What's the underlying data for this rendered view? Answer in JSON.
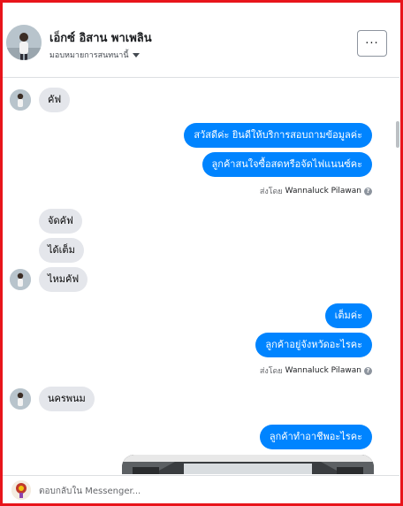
{
  "header": {
    "name": "เอ็กซ์ อิสาน พาเพลิน",
    "status": "มอบหมายการสนทนานี้",
    "more_label": "···"
  },
  "messages": {
    "m0": "คัฟ",
    "m1": "สวัสดีค่ะ  ยินดีให้บริการสอบถามข้อมูลค่ะ",
    "m2": "ลูกค้าสนใจซื้อสดหรือจัดไฟแนนซ์คะ",
    "sent1_prefix": "ส่งโดย",
    "sent1_name": "Wannaluck Pilawan",
    "m3": "จัดคัฟ",
    "m4": "ได้เต็ม",
    "m5": "ไหมคัฟ",
    "m6": "เต็มค่ะ",
    "m7": "ลูกค้าอยู่จังหวัดอะไรคะ",
    "sent2_prefix": "ส่งโดย",
    "sent2_name": "Wannaluck Pilawan",
    "m8": "นครพนม",
    "m9": "ลูกค้าทำอาชีพอะไรคะ"
  },
  "footer": {
    "placeholder": "ตอบกลับใน Messenger..."
  },
  "colors": {
    "outgoing": "#0084ff",
    "incoming": "#e4e6eb",
    "frame": "#e8141b"
  },
  "icons": {
    "more": "more-icon",
    "caret": "caret-down-icon",
    "info": "info-icon"
  }
}
